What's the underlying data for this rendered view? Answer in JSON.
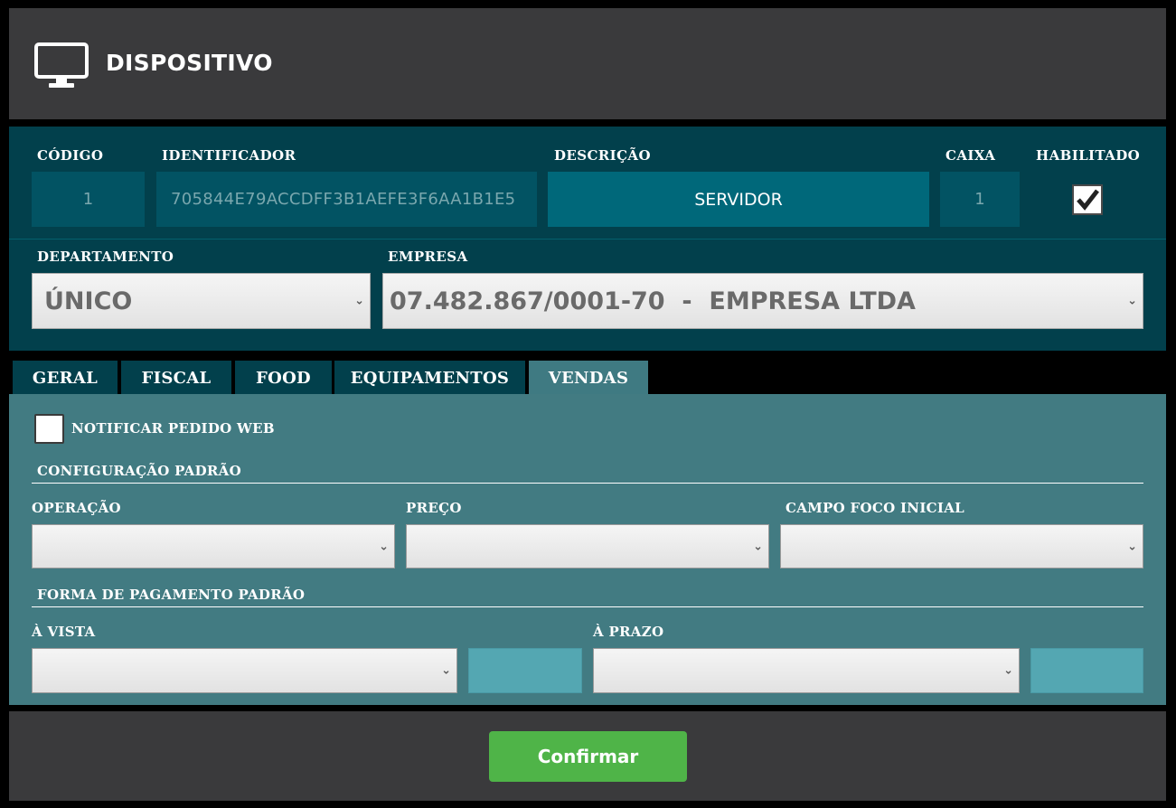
{
  "header": {
    "title": "DISPOSITIVO",
    "icon": "monitor-icon"
  },
  "device": {
    "codigo_label": "CÓDIGO",
    "codigo_value": "1",
    "identificador_label": "IDENTIFICADOR",
    "identificador_value": "705844E79ACCDFF3B1AEFE3F6AA1B1E5",
    "descricao_label": "DESCRIÇÃO",
    "descricao_value": "SERVIDOR",
    "caixa_label": "CAIXA",
    "caixa_value": "1",
    "habilitado_label": "HABILITADO",
    "habilitado_checked": true,
    "departamento_label": "DEPARTAMENTO",
    "departamento_value": "ÚNICO",
    "empresa_label": "EMPRESA",
    "empresa_value": "07.482.867/0001-70  -  EMPRESA LTDA"
  },
  "tabs": [
    {
      "label": "GERAL",
      "active": false
    },
    {
      "label": "FISCAL",
      "active": false
    },
    {
      "label": "FOOD",
      "active": false
    },
    {
      "label": "EQUIPAMENTOS",
      "active": false
    },
    {
      "label": "VENDAS",
      "active": true
    }
  ],
  "vendas": {
    "notificar_label": "NOTIFICAR PEDIDO WEB",
    "notificar_checked": false,
    "config_section": "CONFIGURAÇÃO PADRÃO",
    "operacao_label": "OPERAÇÃO",
    "operacao_value": "",
    "preco_label": "PREÇO",
    "preco_value": "",
    "campo_foco_label": "CAMPO FOCO INICIAL",
    "campo_foco_value": "",
    "pagamento_section": "FORMA DE PAGAMENTO PADRÃO",
    "a_vista_label": "À VISTA",
    "a_vista_value": "",
    "a_prazo_label": "À PRAZO",
    "a_prazo_value": ""
  },
  "footer": {
    "confirm_label": "Confirmar"
  },
  "colors": {
    "header_bg": "#3a3a3c",
    "panel_bg": "#02404c",
    "content_bg": "#427b82",
    "confirm_bg": "#4fb448",
    "description_bg": "#00687a"
  }
}
